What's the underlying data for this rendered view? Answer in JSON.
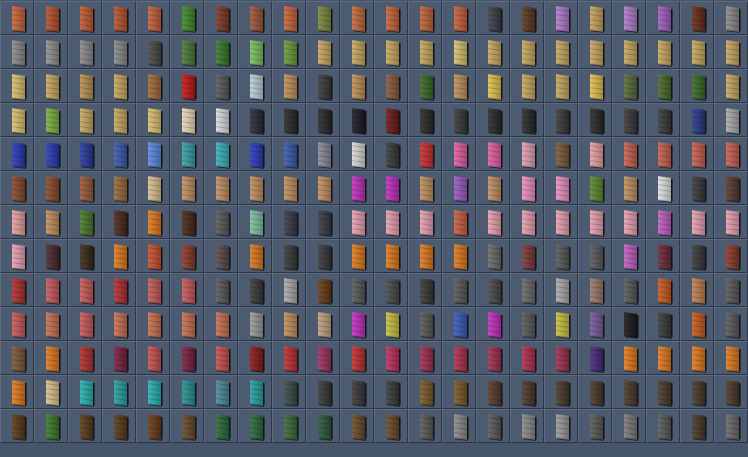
{
  "grid": {
    "columns": 22,
    "rows": 13,
    "item_icon": "door-texture-icon",
    "colors": [
      [
        "#c8643a",
        "#b5512f",
        "#c05a35",
        "#b8542e",
        "#c2603a",
        "#3f8a2a",
        "#7a3a26",
        "#a0553a",
        "#c8643a",
        "#7a8a3a",
        "#c06a3a",
        "#c8643a",
        "#c0643a",
        "#c8603a",
        "#3a3f48",
        "#5a3a22",
        "#b07acc",
        "#c8a060",
        "#b07acc",
        "#a060c0",
        "#6a2a1a",
        "#8a8a8a"
      ],
      [
        "#8a8a8a",
        "#909090",
        "#8a8a8a",
        "#8a8a8a",
        "#4a4a4a",
        "#4a7a3a",
        "#3a7a2a",
        "#7ac060",
        "#6a9a3a",
        "#c8a860",
        "#c8a860",
        "#c8a860",
        "#c8a860",
        "#d8c070",
        "#c8a860",
        "#c8a860",
        "#c8a860",
        "#c8a860",
        "#c8a860",
        "#c8a860",
        "#c8a860",
        "#c8a860"
      ],
      [
        "#d8c070",
        "#c8a860",
        "#b89050",
        "#c8a860",
        "#a06a3a",
        "#c01818",
        "#5a5a5a",
        "#b8d0d8",
        "#c0905a",
        "#3a3a3a",
        "#c0905a",
        "#8a5a3a",
        "#3a6a2a",
        "#c0905a",
        "#e0c050",
        "#c8a860",
        "#c8a860",
        "#e0c050",
        "#5a6a3a",
        "#4a6a2a",
        "#3a6a2a",
        "#c8a860"
      ],
      [
        "#d8c070",
        "#7ab040",
        "#c8a860",
        "#c8a860",
        "#d8c070",
        "#e8d8b8",
        "#d8d8e0",
        "#2a2a38",
        "#2a2a2a",
        "#2a2a2a",
        "#1a1a22",
        "#6a1a1a",
        "#2a2a2a",
        "#3a3a3a",
        "#2a2a2a",
        "#2a2a2a",
        "#3a3a3a",
        "#2a2a2a",
        "#3a3a3a",
        "#3a3a3a",
        "#2a3a8a",
        "#aaaaaa"
      ],
      [
        "#2a3ab8",
        "#2a3ab8",
        "#2a3a9a",
        "#3a5ab0",
        "#5a8ae0",
        "#3aa0a8",
        "#3ab0b8",
        "#2a3ab8",
        "#3a5ab0",
        "#8a8a9a",
        "#d8d8d0",
        "#3a3a3a",
        "#c83030",
        "#e060a0",
        "#e060a0",
        "#e0a0b0",
        "#7a5a3a",
        "#e8a0a0",
        "#c86050",
        "#c86050",
        "#c86050",
        "#c86050"
      ],
      [
        "#8a4a2a",
        "#8a4a2a",
        "#9a5a3a",
        "#9a6a3a",
        "#d8c090",
        "#c09060",
        "#c09060",
        "#c09060",
        "#c09060",
        "#c09060",
        "#c030c0",
        "#c030c0",
        "#c09060",
        "#9a5ac0",
        "#c09060",
        "#e890c0",
        "#e890c0",
        "#5a8a2a",
        "#c09060",
        "#e0e0e0",
        "#3a3a3a",
        "#5a3a2a"
      ],
      [
        "#e8a0a0",
        "#c09060",
        "#4a7a2a",
        "#4a2a1a",
        "#e07a20",
        "#4a2a1a",
        "#5a5a5a",
        "#80c0a0",
        "#3a3a48",
        "#3a3a48",
        "#e8a0b0",
        "#e8a0b0",
        "#e8a0b0",
        "#c86040",
        "#e8a0b0",
        "#e8a0b0",
        "#e8a0b0",
        "#e8a0b0",
        "#e8a0b0",
        "#c060c0",
        "#e8a0b0",
        "#e8a0b0"
      ],
      [
        "#e8a0b0",
        "#4a2a30",
        "#3a2a1a",
        "#e07a20",
        "#c85030",
        "#8a3a2a",
        "#5a4a4a",
        "#d87a20",
        "#3a3a3a",
        "#3a3a3a",
        "#e07a20",
        "#e07a20",
        "#e07a20",
        "#e07a20",
        "#6a6a6a",
        "#7a3a3a",
        "#5a5a5a",
        "#5a5a5a",
        "#c060c0",
        "#6a2a3a",
        "#3a3a3a",
        "#8a3a2a"
      ],
      [
        "#b03030",
        "#c85a5a",
        "#c85a5a",
        "#b03030",
        "#c85a5a",
        "#c85a5a",
        "#5a5a5a",
        "#3a3a3a",
        "#aaaaaa",
        "#6a3a1a",
        "#5a5a5a",
        "#4a4a4a",
        "#3a3a3a",
        "#5a5a5a",
        "#4a4a4a",
        "#6a6a6a",
        "#aaaaaa",
        "#9a7a6a",
        "#5a5a5a",
        "#c85a20",
        "#c08050",
        "#5a5a5a"
      ],
      [
        "#c85a5a",
        "#c87050",
        "#c85a5a",
        "#c87050",
        "#c87050",
        "#c87050",
        "#c87050",
        "#9a9a9a",
        "#c09060",
        "#c0a080",
        "#c030c0",
        "#c8c040",
        "#5a5a5a",
        "#3a5ab8",
        "#c030c0",
        "#5a5a5a",
        "#c8c040",
        "#7a5a9a",
        "#1a1a1a",
        "#3a3a3a",
        "#c85a20",
        "#5a5a5a"
      ],
      [
        "#7a5a3a",
        "#e07a20",
        "#b03030",
        "#7a2040",
        "#c85050",
        "#7a2040",
        "#c85050",
        "#8a1a1a",
        "#c03030",
        "#a03060",
        "#c03030",
        "#c03060",
        "#a03050",
        "#b03050",
        "#a03050",
        "#b03050",
        "#a03050",
        "#4a2a7a",
        "#e07a20",
        "#e07a20",
        "#e07a20",
        "#e07a20"
      ],
      [
        "#e07a20",
        "#d8c090",
        "#2ab0b0",
        "#2aa0a0",
        "#2ab0b0",
        "#2a9090",
        "#4a8a9a",
        "#2aa0a0",
        "#3a4a4a",
        "#3a3a3a",
        "#3a3a3a",
        "#3a3a3a",
        "#7a5a2a",
        "#7a5a2a",
        "#5a3a2a",
        "#4a3a2a",
        "#4a3a2a",
        "#4a3a2a",
        "#4a3a2a",
        "#4a3a2a",
        "#4a3a2a",
        "#4a3a2a"
      ],
      [
        "#5a3a1a",
        "#3a7a2a",
        "#5a3a1a",
        "#5a3a1a",
        "#6a3a1a",
        "#6a4a2a",
        "#2a6a3a",
        "#2a6a3a",
        "#3a6a3a",
        "#2a5a3a",
        "#6a4a2a",
        "#6a4a2a",
        "#5a5a5a",
        "#8a8a8a",
        "#5a5a5a",
        "#8a8a8a",
        "#9a9a9a",
        "#5a5a5a",
        "#7a7a7a",
        "#5a5a5a",
        "#4a3a2a",
        "#6a6a6a"
      ]
    ]
  }
}
